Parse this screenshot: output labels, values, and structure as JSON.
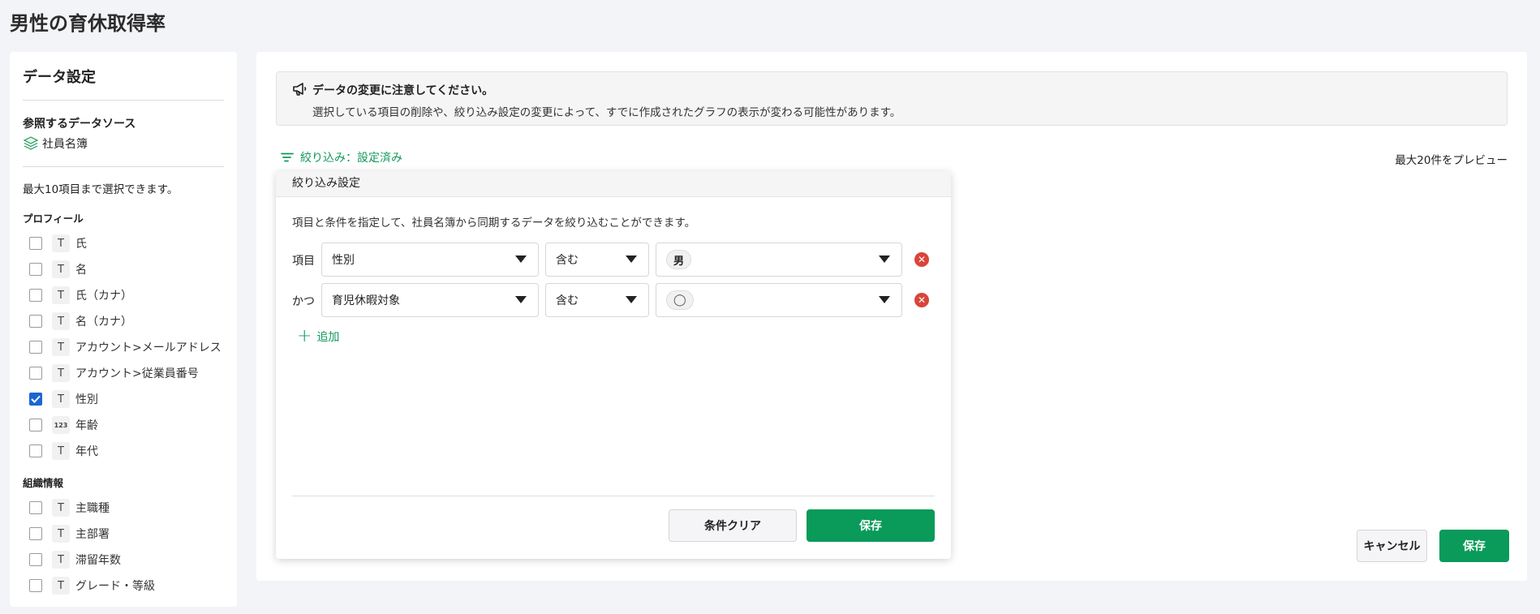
{
  "page": {
    "title": "男性の育休取得率"
  },
  "left": {
    "title": "データ設定",
    "datasource_title": "参照するデータソース",
    "datasource_name": "社員名簿",
    "limit_note": "最大10項目まで選択できます。",
    "profile_title": "プロフィール",
    "profile_fields": [
      {
        "label": "氏",
        "type": "T",
        "checked": false
      },
      {
        "label": "名",
        "type": "T",
        "checked": false
      },
      {
        "label": "氏（カナ）",
        "type": "T",
        "checked": false
      },
      {
        "label": "名（カナ）",
        "type": "T",
        "checked": false
      },
      {
        "label": "アカウント>メールアドレス",
        "type": "T",
        "checked": false
      },
      {
        "label": "アカウント>従業員番号",
        "type": "T",
        "checked": false
      },
      {
        "label": "性別",
        "type": "T",
        "checked": true
      },
      {
        "label": "年齢",
        "type": "123",
        "checked": false
      },
      {
        "label": "年代",
        "type": "T",
        "checked": false
      }
    ],
    "org_title": "組織情報",
    "org_fields": [
      {
        "label": "主職種",
        "type": "T",
        "checked": false
      },
      {
        "label": "主部署",
        "type": "T",
        "checked": false
      },
      {
        "label": "滞留年数",
        "type": "T",
        "checked": false
      },
      {
        "label": "グレード・等級",
        "type": "T",
        "checked": false
      }
    ]
  },
  "notice": {
    "title": "データの変更に注意してください。",
    "body": "選択している項目の削除や、絞り込み設定の変更によって、すでに作成されたグラフの表示が変わる可能性があります。"
  },
  "filter_link": "絞り込み：設定済み",
  "preview_note": "最大20件をプレビュー",
  "popup": {
    "title": "絞り込み設定",
    "desc": "項目と条件を指定して、社員名簿から同期するデータを絞り込むことができます。",
    "conditions": [
      {
        "label": "項目",
        "field": "性別",
        "operator": "含む",
        "value": "男"
      },
      {
        "label": "かつ",
        "field": "育児休暇対象",
        "operator": "含む",
        "value": "◯"
      }
    ],
    "add_label": "追加",
    "clear_label": "条件クリア",
    "save_label": "保存"
  },
  "footer": {
    "cancel_label": "キャンセル",
    "save_label": "保存"
  },
  "colors": {
    "accent_green": "#0a9a5a",
    "check_blue": "#1a66d2",
    "delete_red": "#d9453b"
  }
}
